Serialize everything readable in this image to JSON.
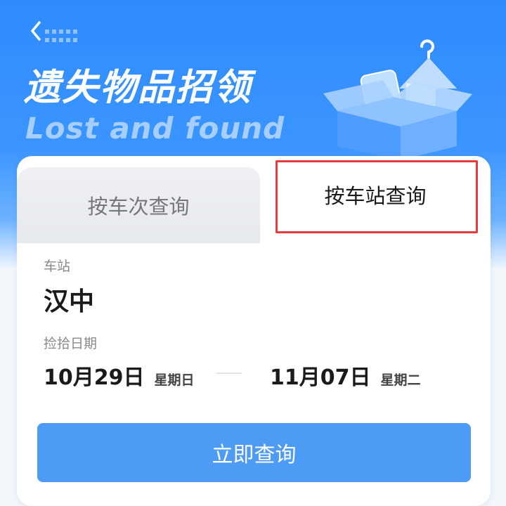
{
  "header": {
    "title": "遗失物品招领",
    "subtitle": "Lost and found"
  },
  "icons": {
    "back": "back-icon",
    "illustration": "box-hanger-icon"
  },
  "tabs": [
    {
      "label": "按车次查询",
      "active": false
    },
    {
      "label": "按车站查询",
      "active": true
    }
  ],
  "form": {
    "station_label": "车站",
    "station_value": "汉中",
    "date_label": "捡拾日期",
    "start_date": "10月29日",
    "start_weekday": "星期日",
    "end_date": "11月07日",
    "end_weekday": "星期二"
  },
  "actions": {
    "query_label": "立即查询"
  },
  "colors": {
    "hero": "#2f8bff",
    "button": "#4e9bf5",
    "highlight": "#e53b3b"
  }
}
